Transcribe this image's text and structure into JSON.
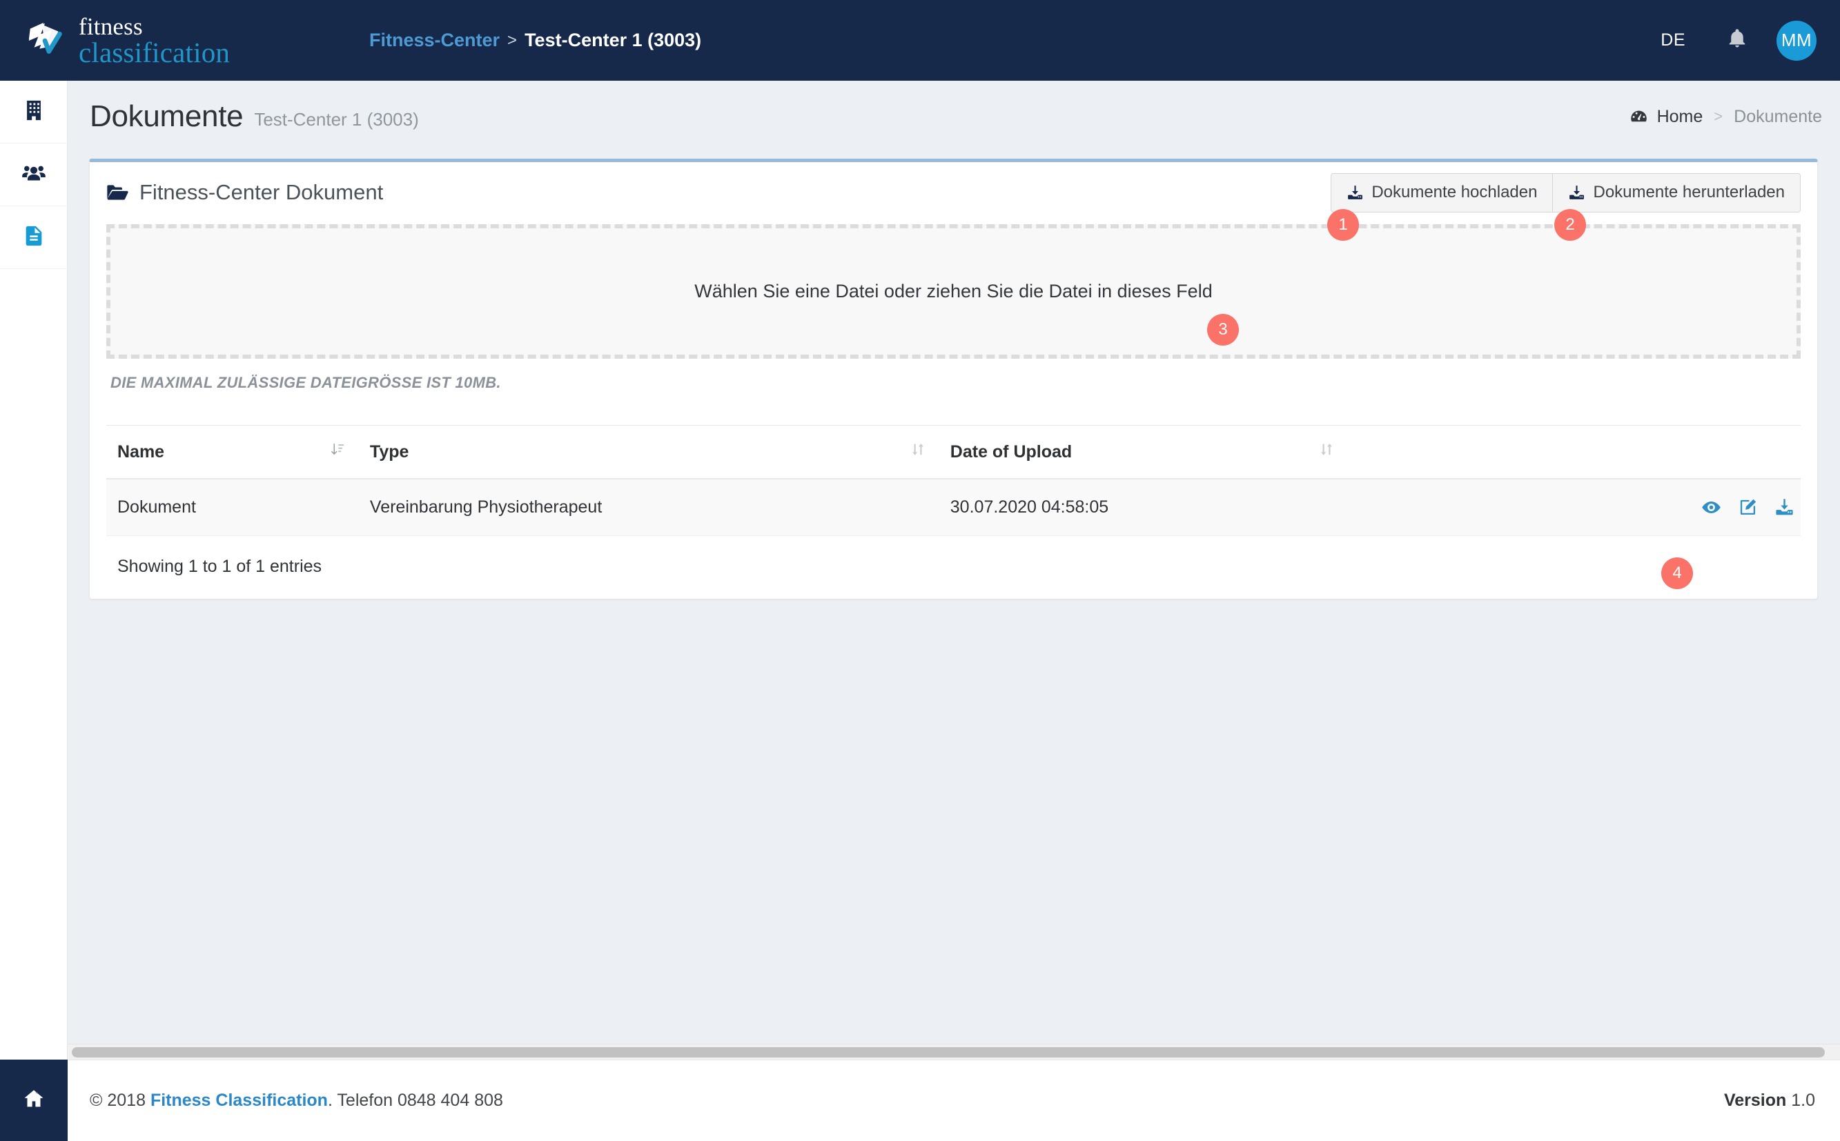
{
  "navbar": {
    "brand": {
      "line1": "fitness",
      "line2": "classification",
      "logo_icon": "swoosh-check-logo"
    },
    "breadcrumb": {
      "parent": "Fitness-Center",
      "separator": ">",
      "current": "Test-Center 1 (3003)"
    },
    "language": "DE",
    "bell_icon": "bell-icon",
    "avatar_initials": "MM"
  },
  "sidebar": {
    "items": [
      {
        "icon": "building-icon",
        "name": "sidebar-item-building",
        "active": false
      },
      {
        "icon": "users-icon",
        "name": "sidebar-item-users",
        "active": false
      },
      {
        "icon": "document-icon",
        "name": "sidebar-item-documents",
        "active": true
      }
    ],
    "bottom_icon": "home-icon"
  },
  "page": {
    "title": "Dokumente",
    "subtitle": "Test-Center 1 (3003)",
    "breadcrumb": {
      "icon": "dashboard-icon",
      "home": "Home",
      "separator": ">",
      "current": "Dokumente"
    }
  },
  "card": {
    "icon": "folder-open-icon",
    "title": "Fitness-Center Dokument",
    "upload_button": {
      "label": "Dokumente hochladen",
      "icon": "download-tray-icon"
    },
    "download_button": {
      "label": "Dokumente herunterladen",
      "icon": "download-tray-icon"
    },
    "dropzone_text": "Wählen Sie eine Datei oder ziehen Sie die Datei in dieses Feld",
    "maxsize_note": "DIE MAXIMAL ZULÄSSIGE DATEIGRÖSSE IST 10MB."
  },
  "table": {
    "columns": [
      {
        "label": "Name",
        "sort": "sort-amount-down-icon"
      },
      {
        "label": "Type",
        "sort": "sort-updown-icon"
      },
      {
        "label": "Date of Upload",
        "sort": "sort-updown-icon"
      },
      {
        "label": "",
        "sort": ""
      },
      {
        "label": "",
        "sort": ""
      }
    ],
    "rows": [
      {
        "name": "Dokument",
        "type": "Vereinbarung Physiotherapeut",
        "date": "30.07.2020 04:58:05",
        "actions": [
          "eye-icon",
          "edit-pencil-icon",
          "download-tray-icon"
        ]
      }
    ],
    "info": "Showing 1 to 1 of 1 entries"
  },
  "annotations": [
    {
      "label": "1"
    },
    {
      "label": "2"
    },
    {
      "label": "3"
    },
    {
      "label": "4"
    }
  ],
  "footer": {
    "copyright_pre": "© 2018 ",
    "copyright_brand": "Fitness Classification",
    "copyright_post": ". Telefon 0848 404 808",
    "version_label": "Version",
    "version_value": " 1.0"
  },
  "colors": {
    "navy": "#16294a",
    "brand_blue": "#2196c9",
    "accent_blue": "#1a9bd7",
    "annotation": "#fa7268",
    "page_bg": "#eceff4",
    "card_top_border": "#93bada"
  }
}
